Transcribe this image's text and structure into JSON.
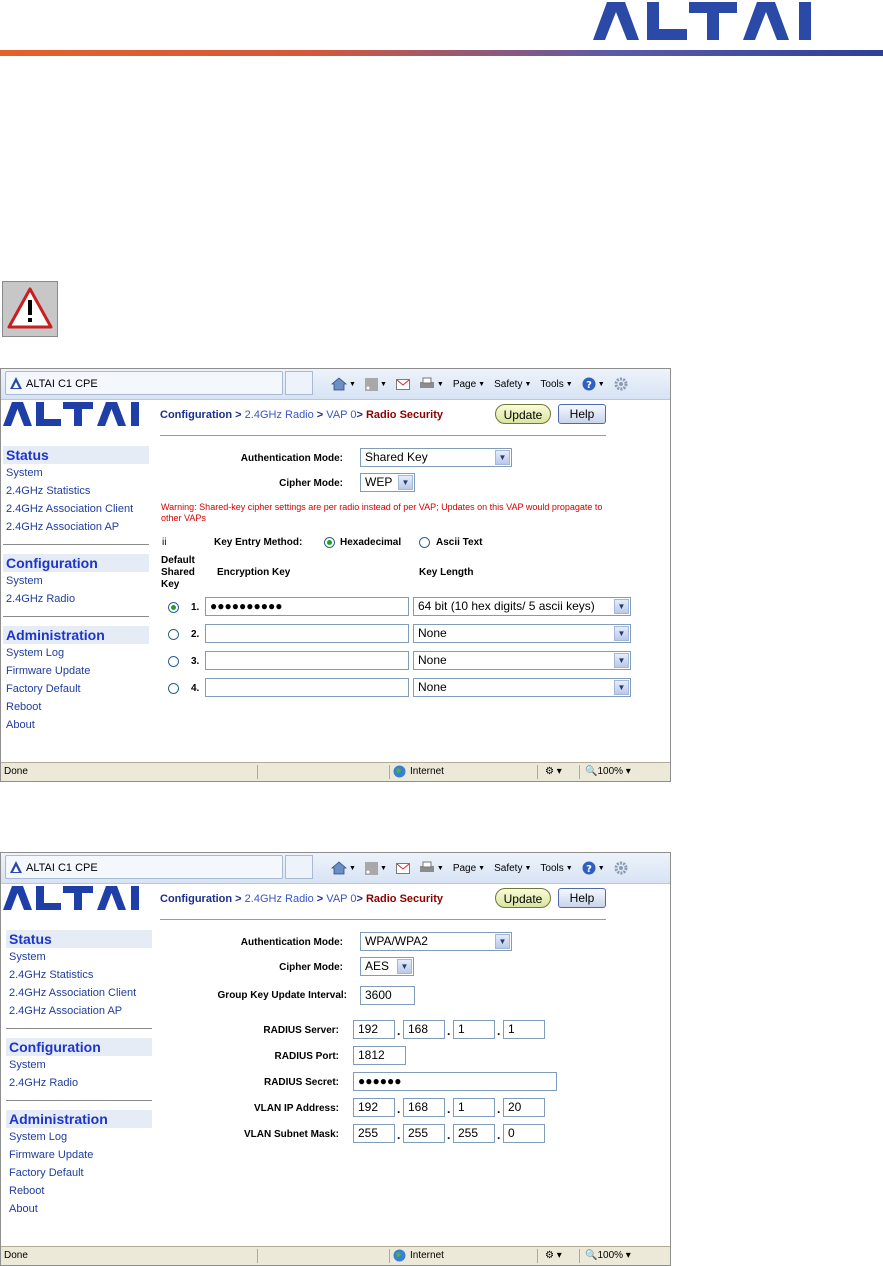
{
  "document": {
    "logo_text": "ALTAI"
  },
  "browser": {
    "tab_title": "ALTAI C1 CPE",
    "toolbar": {
      "page_label": "Page",
      "safety_label": "Safety",
      "tools_label": "Tools"
    },
    "status": {
      "done": "Done",
      "zone": "Internet",
      "zoom": "100%"
    }
  },
  "nav": {
    "status_heading": "Status",
    "status_items": [
      "System",
      "2.4GHz Statistics",
      "2.4GHz Association Client",
      "2.4GHz Association AP"
    ],
    "config_heading": "Configuration",
    "config_items": [
      "System",
      "2.4GHz Radio"
    ],
    "admin_heading": "Administration",
    "admin_items": [
      "System Log",
      "Firmware Update",
      "Factory Default",
      "Reboot",
      "About"
    ]
  },
  "breadcrumb": {
    "part1": "Configuration",
    "sep1": " > ",
    "part2": "2.4GHz Radio",
    "sep2": " > ",
    "part3": "VAP 0",
    "sep3": "> ",
    "part4": "Radio Security"
  },
  "buttons": {
    "update": "Update",
    "help": "Help"
  },
  "wep_page": {
    "auth_label": "Authentication Mode:",
    "auth_value": "Shared Key",
    "cipher_label": "Cipher Mode:",
    "cipher_value": "WEP",
    "warning": "Warning: Shared-key cipher settings are per radio instead of per VAP; Updates on this VAP would propagate to other VAPs",
    "marker": "ii",
    "key_entry_label": "Key Entry Method:",
    "key_entry_hex": "Hexadecimal",
    "key_entry_ascii": "Ascii Text",
    "col_default": "Default Shared Key",
    "col_encryption": "Encryption Key",
    "col_length": "Key Length",
    "keys": [
      {
        "index": "1.",
        "value": "●●●●●●●●●●",
        "length": "64 bit (10 hex digits/ 5 ascii keys)",
        "selected": true
      },
      {
        "index": "2.",
        "value": "",
        "length": "None",
        "selected": false
      },
      {
        "index": "3.",
        "value": "",
        "length": "None",
        "selected": false
      },
      {
        "index": "4.",
        "value": "",
        "length": "None",
        "selected": false
      }
    ]
  },
  "wpa_page": {
    "auth_label": "Authentication Mode:",
    "auth_value": "WPA/WPA2",
    "cipher_label": "Cipher Mode:",
    "cipher_value": "AES",
    "group_key_label": "Group Key Update Interval:",
    "group_key_value": "3600",
    "radius_server_label": "RADIUS Server:",
    "radius_server": [
      "192",
      "168",
      "1",
      "1"
    ],
    "radius_port_label": "RADIUS Port:",
    "radius_port": "1812",
    "radius_secret_label": "RADIUS Secret:",
    "radius_secret": "●●●●●●",
    "vlan_ip_label": "VLAN IP Address:",
    "vlan_ip": [
      "192",
      "168",
      "1",
      "20"
    ],
    "vlan_mask_label": "VLAN Subnet Mask:",
    "vlan_mask": [
      "255",
      "255",
      "255",
      "0"
    ]
  }
}
